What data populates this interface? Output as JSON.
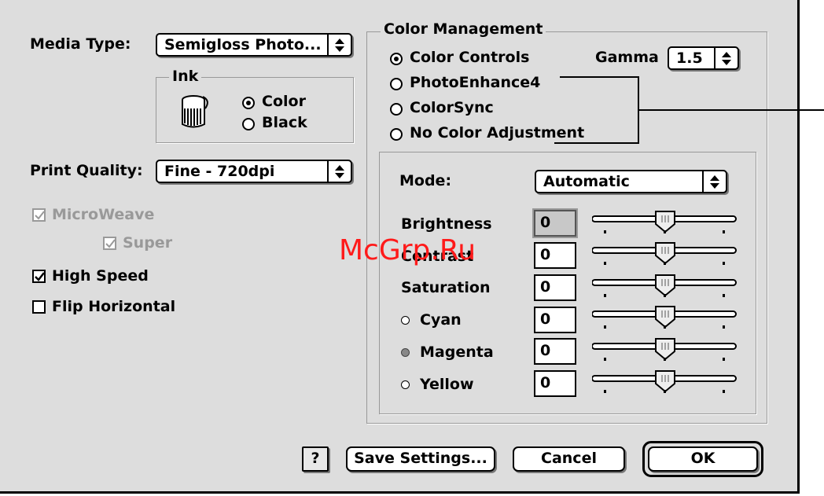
{
  "media_type": {
    "label": "Media Type:",
    "value": "Semigloss Photo..."
  },
  "ink": {
    "title": "Ink",
    "options": [
      "Color",
      "Black"
    ],
    "selected": "Color"
  },
  "print_quality": {
    "label": "Print Quality:",
    "value": "Fine - 720dpi"
  },
  "checkboxes": {
    "microweave": {
      "label": "MicroWeave",
      "checked": true,
      "enabled": false
    },
    "super": {
      "label": "Super",
      "checked": true,
      "enabled": false
    },
    "high_speed": {
      "label": "High Speed",
      "checked": true,
      "enabled": true
    },
    "flip_horizontal": {
      "label": "Flip Horizontal",
      "checked": false,
      "enabled": true
    }
  },
  "color_management": {
    "title": "Color Management",
    "options": [
      "Color Controls",
      "PhotoEnhance4",
      "ColorSync",
      "No Color Adjustment"
    ],
    "selected": "Color Controls",
    "gamma": {
      "label": "Gamma",
      "value": "1.5"
    },
    "mode": {
      "label": "Mode:",
      "value": "Automatic"
    },
    "sliders": [
      {
        "label": "Brightness",
        "value": "0"
      },
      {
        "label": "Contrast",
        "value": "0"
      },
      {
        "label": "Saturation",
        "value": "0"
      },
      {
        "label": "Cyan",
        "value": "0"
      },
      {
        "label": "Magenta",
        "value": "0"
      },
      {
        "label": "Yellow",
        "value": "0"
      }
    ]
  },
  "buttons": {
    "help": "?",
    "save": "Save Settings...",
    "cancel": "Cancel",
    "ok": "OK"
  },
  "watermark": "McGrp.Ru"
}
